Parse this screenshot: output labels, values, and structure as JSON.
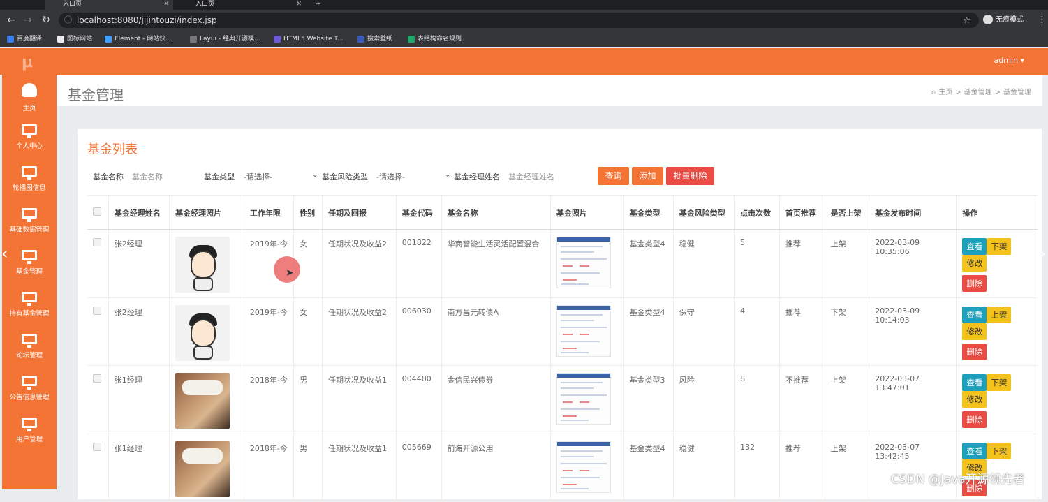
{
  "browser": {
    "tabs": [
      "入口页",
      "入口页"
    ],
    "url": "localhost:8080/jijintouzi/index.jsp",
    "incognito_label": "无痕模式",
    "bookmarks": [
      "百度翻译",
      "图标网站",
      "Element - 网站快...",
      "Layui - 经典开源模...",
      "HTML5 Website T...",
      "搜索壁纸",
      "表结构命名规则"
    ]
  },
  "header": {
    "user": "admin ▾"
  },
  "sidebar": {
    "logo": "μ",
    "items": [
      {
        "label": "主页",
        "icon": "dashboard-icon"
      },
      {
        "label": "个人中心",
        "icon": "monitor-icon"
      },
      {
        "label": "轮播图信息",
        "icon": "monitor-icon"
      },
      {
        "label": "基础数据管理",
        "icon": "monitor-icon"
      },
      {
        "label": "基金管理",
        "icon": "monitor-icon"
      },
      {
        "label": "持有基金管理",
        "icon": "monitor-icon"
      },
      {
        "label": "论坛管理",
        "icon": "monitor-icon"
      },
      {
        "label": "公告信息管理",
        "icon": "monitor-icon"
      },
      {
        "label": "用户管理",
        "icon": "monitor-icon"
      }
    ]
  },
  "page": {
    "title": "基金管理",
    "breadcrumb": [
      "主页",
      ">",
      "基金管理",
      ">",
      "基金管理"
    ]
  },
  "card": {
    "title": "基金列表",
    "filters": {
      "fund_name_label": "基金名称",
      "fund_name_placeholder": "基金名称",
      "fund_type_label": "基金类型",
      "fund_type_value": "-请选择-",
      "risk_type_label": "基金风险类型",
      "risk_type_value": "-请选择-",
      "manager_label": "基金经理姓名",
      "manager_placeholder": "基金经理姓名"
    },
    "buttons": {
      "query": "查询",
      "add": "添加",
      "batch_delete": "批量删除"
    }
  },
  "table": {
    "columns": [
      "基金经理姓名",
      "基金经理照片",
      "工作年限",
      "性别",
      "任期及回报",
      "基金代码",
      "基金名称",
      "基金照片",
      "基金类型",
      "基金风险类型",
      "点击次数",
      "首页推荐",
      "是否上架",
      "基金发布时间",
      "操作"
    ],
    "rows": [
      {
        "manager": "张2经理",
        "photo": "cartoon",
        "years": "2019年-今",
        "gender": "女",
        "tenure": "任期状况及收益2",
        "code": "001822",
        "name": "华商智能生活灵活配置混合",
        "type": "基金类型4",
        "risk": "稳健",
        "clicks": "5",
        "recommend": "推荐",
        "shelf": "上架",
        "time": "2022-03-09 10:35:06",
        "shelf_action": "下架"
      },
      {
        "manager": "张2经理",
        "photo": "cartoon",
        "years": "2019年-今",
        "gender": "女",
        "tenure": "任期状况及收益2",
        "code": "006030",
        "name": "南方昌元转债A",
        "type": "基金类型4",
        "risk": "保守",
        "clicks": "4",
        "recommend": "推荐",
        "shelf": "下架",
        "time": "2022-03-09 10:14:03",
        "shelf_action": "上架"
      },
      {
        "manager": "张1经理",
        "photo": "cat",
        "years": "2018年-今",
        "gender": "男",
        "tenure": "任期状况及收益1",
        "code": "004400",
        "name": "金信民兴债券",
        "type": "基金类型3",
        "risk": "风险",
        "clicks": "8",
        "recommend": "不推荐",
        "shelf": "上架",
        "time": "2022-03-07 13:47:01",
        "shelf_action": "下架"
      },
      {
        "manager": "张1经理",
        "photo": "cat",
        "years": "2018年-今",
        "gender": "男",
        "tenure": "任期状况及收益1",
        "code": "005669",
        "name": "前海开源公用",
        "type": "基金类型4",
        "risk": "稳健",
        "clicks": "132",
        "recommend": "推荐",
        "shelf": "上架",
        "time": "2022-03-07 13:42:45",
        "shelf_action": "下架"
      }
    ],
    "ops": {
      "view": "查看",
      "edit": "修改",
      "delete": "删除"
    }
  },
  "watermark": "CSDN @Java开源领先者",
  "colors": {
    "primary": "#f47435",
    "danger": "#ea4c43",
    "info": "#1e9fbb",
    "warning": "#f4c21c"
  }
}
